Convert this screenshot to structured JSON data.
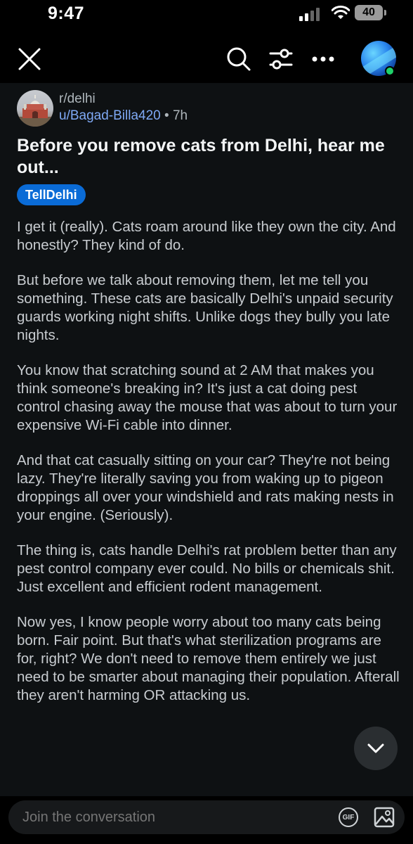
{
  "status_bar": {
    "time": "9:47",
    "battery": "40"
  },
  "post": {
    "subreddit": "r/delhi",
    "author": "u/Bagad-Billa420",
    "separator": "•",
    "age": "7h",
    "title": "Before you remove cats from Delhi, hear me out...",
    "flair": "TellDelhi",
    "paragraphs": [
      "I get it (really). Cats roam around like they own the city. And honestly? They kind of do.",
      "But before we talk about removing them, let me tell you something. These cats are basically Delhi's unpaid security guards working night shifts. Unlike dogs they bully you late nights.",
      "You know that scratching sound at 2 AM that makes you think someone's breaking in? It's just a cat doing pest control chasing away the mouse that was about to turn your expensive Wi-Fi cable into dinner.",
      "And that cat casually sitting on your car? They're not being lazy. They're literally saving you from waking up to pigeon droppings all over your windshield and rats making nests in your engine. (Seriously).",
      "The thing is, cats handle Delhi's rat problem better than any pest control company ever could. No bills or chemicals shit. Just excellent  and efficient rodent management.",
      "Now yes, I know people worry about too many cats being born. Fair point. But that's what sterilization programs are for, right? We don't need to remove them entirely we just need to be smarter about managing their population. Afterall they aren't harming OR attacking us."
    ]
  },
  "reply": {
    "placeholder": "Join the conversation",
    "gif_label": "GIF"
  },
  "icons": {
    "close": "close-icon",
    "search": "search-icon",
    "filter": "filter-icon",
    "more": "more-icon",
    "avatar": "user-avatar",
    "scroll": "chevron-down-icon",
    "gif": "gif-icon",
    "image": "image-icon"
  },
  "colors": {
    "flair_bg": "#0a6bd6",
    "username": "#7fa9f5",
    "online": "#1fd16a"
  }
}
